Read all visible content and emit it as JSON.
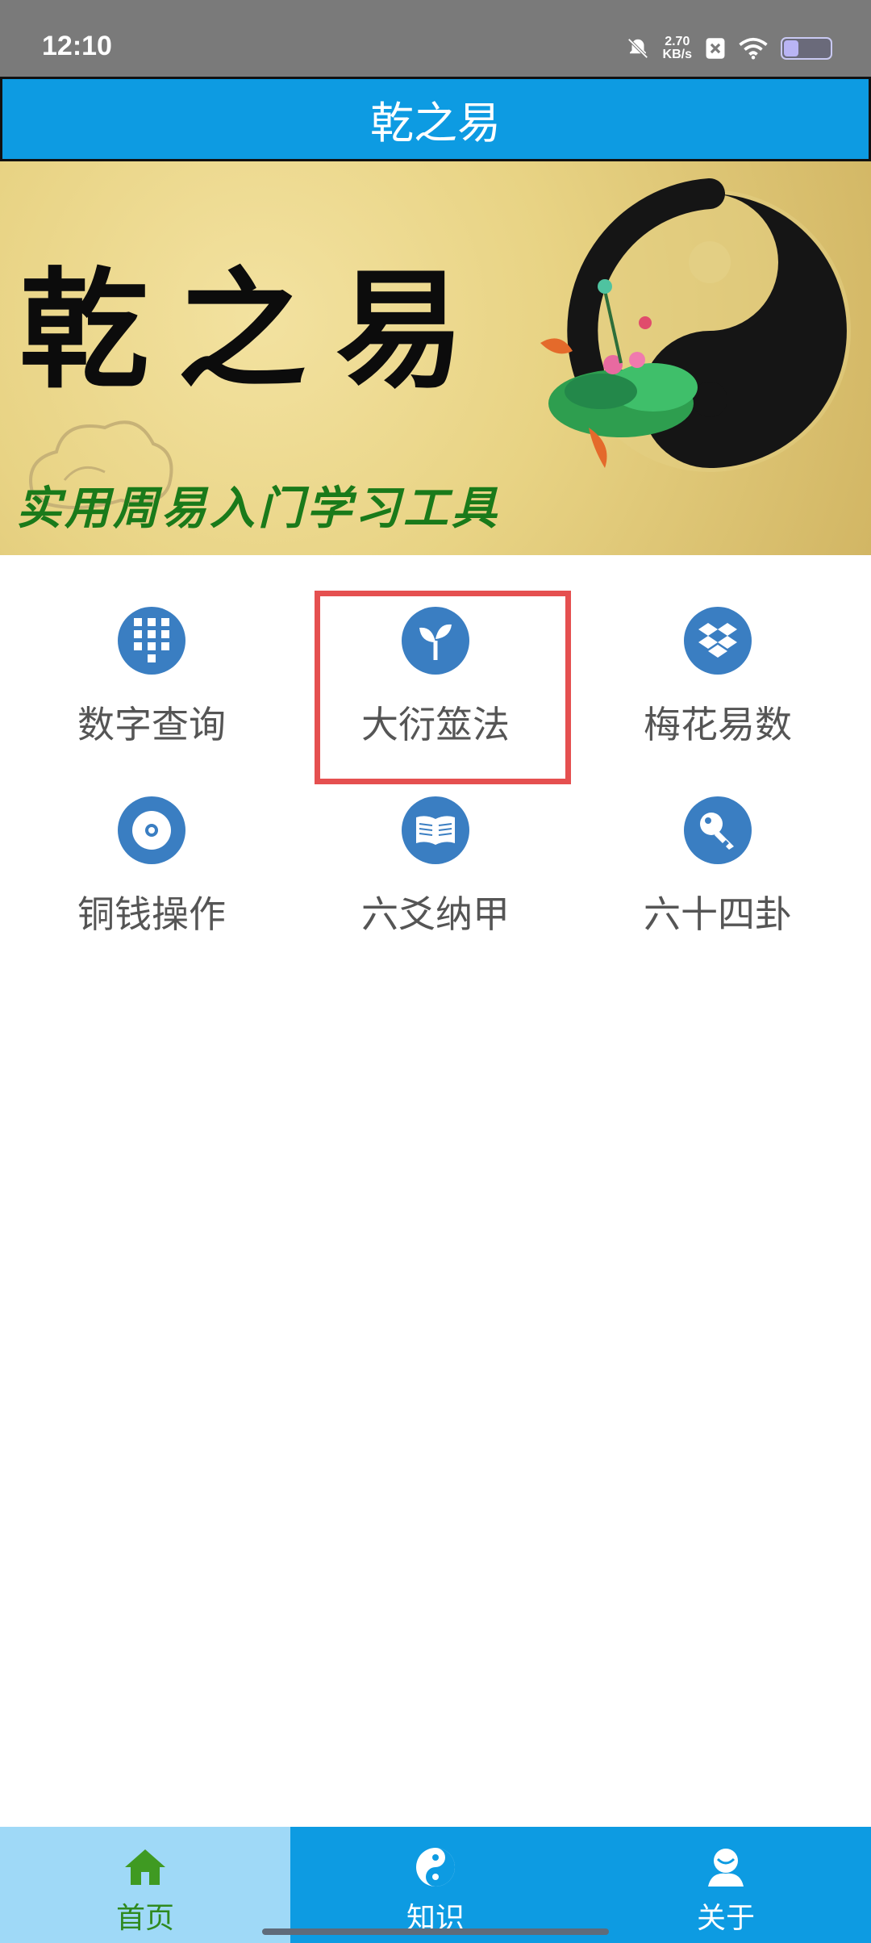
{
  "status_bar": {
    "time": "12:10",
    "network_rate": "2.70",
    "network_rate_unit": "KB/s"
  },
  "header": {
    "title": "乾之易"
  },
  "banner": {
    "title": "乾之易",
    "subtitle": "实用周易入门学习工具"
  },
  "menu": {
    "items": [
      {
        "label": "数字查询",
        "icon": "keypad-icon"
      },
      {
        "label": "大衍筮法",
        "icon": "sprout-icon"
      },
      {
        "label": "梅花易数",
        "icon": "dropbox-icon"
      },
      {
        "label": "铜钱操作",
        "icon": "disc-icon"
      },
      {
        "label": "六爻纳甲",
        "icon": "book-icon"
      },
      {
        "label": "六十四卦",
        "icon": "key-icon"
      }
    ]
  },
  "bottom_nav": {
    "tabs": [
      {
        "label": "首页",
        "icon": "home-icon",
        "active": true
      },
      {
        "label": "知识",
        "icon": "yin-yang-icon",
        "active": false
      },
      {
        "label": "关于",
        "icon": "user-icon",
        "active": false
      }
    ]
  },
  "colors": {
    "accent": "#0d9be2",
    "icon_bg": "#3a7ec2",
    "highlight": "#e55050",
    "active_tab_bg": "#9fd9f7"
  }
}
